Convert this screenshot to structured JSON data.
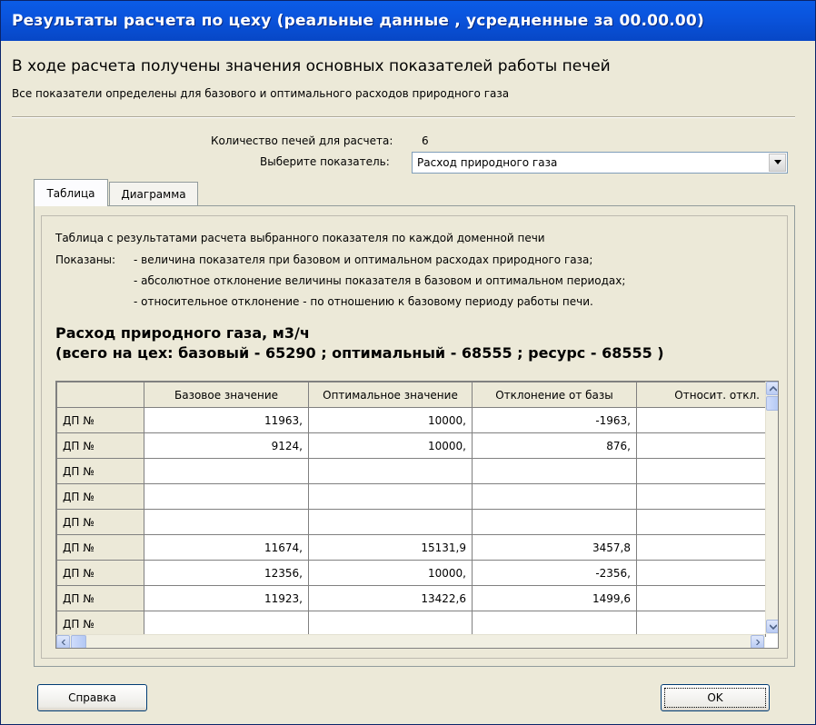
{
  "window": {
    "title": "Результаты расчета по цеху (реальные данные , усредненные за 00.00.00)"
  },
  "intro": {
    "heading": "В ходе расчета получены значения основных показателей работы печей",
    "subheading": "Все показатели определены для базового и оптимального расходов природного газа"
  },
  "params": {
    "count_label": "Количество печей для расчета:",
    "count_value": "6",
    "select_label": "Выберите показатель:",
    "select_value": "Расход природного газа"
  },
  "tabs": [
    {
      "label": "Таблица",
      "active": true
    },
    {
      "label": "Диаграмма",
      "active": false
    }
  ],
  "panel": {
    "desc1": "Таблица с результатами расчета выбранного показателя по каждой доменной печи",
    "desc2_prefix": "Показаны:",
    "desc2": "- величина показателя при базовом и оптимальном расходах природного газа;",
    "desc3": "- абсолютное отклонение величины показателя в базовом и оптимальном периодах;",
    "desc4": "- относительное отклонение - по отношению к базовому периоду работы печи.",
    "big_title": "Расход природного газа, м3/ч",
    "big_summary": "(всего на цех: базовый - 65290 ; оптимальный - 68555 ; ресурс - 68555 )"
  },
  "table": {
    "columns": [
      "",
      "Базовое значение",
      "Оптимальное значение",
      "Отклонение от базы",
      "Относит. откл."
    ],
    "rows": [
      [
        "ДП №",
        "11963,",
        "10000,",
        "-1963,",
        ""
      ],
      [
        "ДП №",
        "9124,",
        "10000,",
        "876,",
        ""
      ],
      [
        "ДП №",
        "",
        "",
        "",
        ""
      ],
      [
        "ДП №",
        "",
        "",
        "",
        ""
      ],
      [
        "ДП №",
        "",
        "",
        "",
        ""
      ],
      [
        "ДП №",
        "11674,",
        "15131,9",
        "3457,8",
        ""
      ],
      [
        "ДП №",
        "12356,",
        "10000,",
        "-2356,",
        ""
      ],
      [
        "ДП №",
        "11923,",
        "13422,6",
        "1499,6",
        ""
      ],
      [
        "ДП №",
        "",
        "",
        "",
        ""
      ]
    ]
  },
  "buttons": {
    "help": "Справка",
    "ok": "OK"
  },
  "icons": {
    "combo": "chevron-down-icon",
    "scroll_up": "arrow-up-icon",
    "scroll_down": "arrow-down-icon",
    "scroll_left": "arrow-left-icon",
    "scroll_right": "arrow-right-icon"
  }
}
